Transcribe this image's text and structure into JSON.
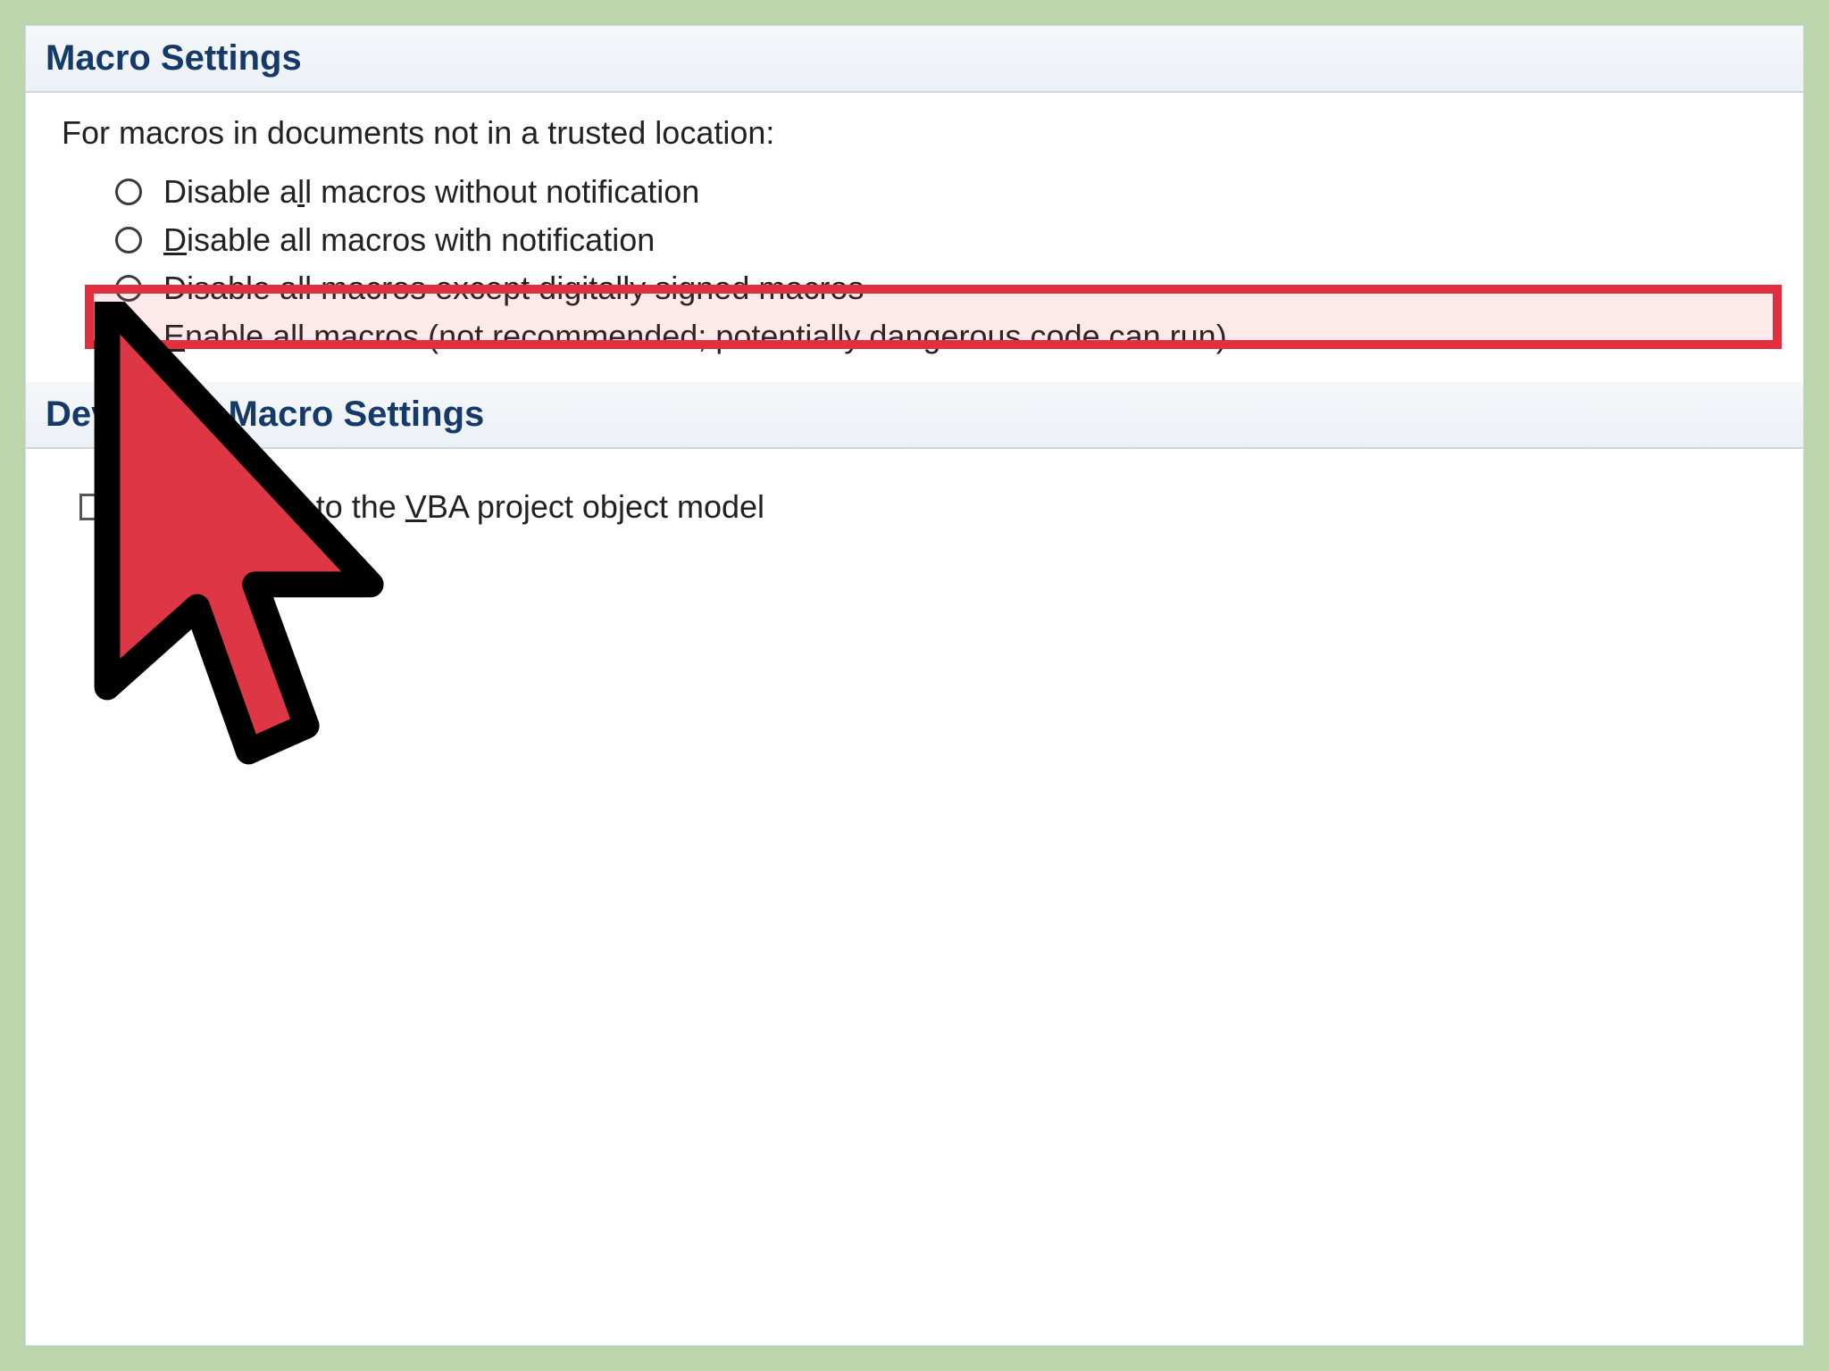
{
  "macro_settings": {
    "header": "Macro Settings",
    "intro": "For macros in documents not in a trusted location:",
    "options": [
      {
        "pre": "Disable a",
        "u": "l",
        "post": "l macros without notification",
        "selected": false
      },
      {
        "pre": "",
        "u": "D",
        "post": "isable all macros with notification",
        "selected": false
      },
      {
        "pre": "Disable all macros except di",
        "u": "g",
        "post": "itally signed macros",
        "selected": false
      },
      {
        "pre": "",
        "u": "E",
        "post": "nable all macros (not recommended; potentially dangerous code can run)",
        "selected": true
      }
    ]
  },
  "developer_settings": {
    "header": "Developer Macro Settings",
    "trust_access": {
      "pre": "Trust access to the ",
      "u": "V",
      "post": "BA project object model",
      "checked": false
    }
  },
  "colors": {
    "highlight_border": "#e22f3f",
    "page_bg": "#bcd5ad"
  }
}
